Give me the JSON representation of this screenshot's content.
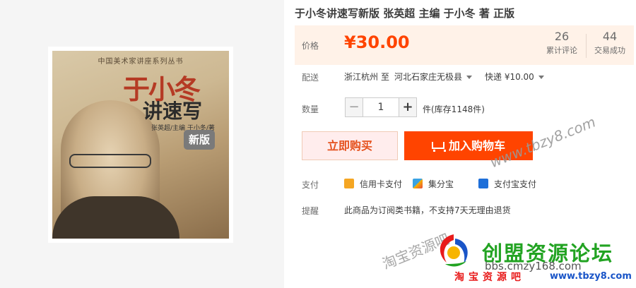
{
  "product": {
    "title": "于小冬讲速写新版 张英超 主编 于小冬 著 正版",
    "cover": {
      "series": "中国美术家讲座系列丛书",
      "main_title": "于小冬",
      "subtitle": "讲速写",
      "author_line": "张英超/主编 于小冬/著",
      "badge": "新版"
    }
  },
  "price": {
    "label": "价格",
    "value": "¥30.00",
    "reviews_count": "26",
    "reviews_label": "累计评论",
    "sales_count": "44",
    "sales_label": "交易成功"
  },
  "shipping": {
    "label": "配送",
    "from": "浙江杭州",
    "to_word": "至",
    "destination": "河北石家庄无极县",
    "method": "快递 ¥10.00"
  },
  "quantity": {
    "label": "数量",
    "minus": "−",
    "value": "1",
    "plus": "+",
    "stock": "件(库存1148件)"
  },
  "actions": {
    "buy_now": "立即购买",
    "add_to_cart": "加入购物车"
  },
  "payment": {
    "label": "支付",
    "options": [
      {
        "name": "信用卡支付",
        "icon": "credit-card-icon",
        "color": "#f5a623"
      },
      {
        "name": "集分宝",
        "icon": "jifenbao-icon",
        "color": "#3aa3e3"
      },
      {
        "name": "支付宝支付",
        "icon": "alipay-icon",
        "color": "#1e6fd9"
      }
    ]
  },
  "notice": {
    "label": "提醒",
    "text": "此商品为订阅类书籍，不支持7天无理由退货"
  },
  "watermark": {
    "site": "www.tbzy8.com",
    "name": "淘宝资源吧",
    "forum": "创盟资源论坛",
    "url": "bbs.cmzy168.com",
    "bottom_text": "淘宝资源吧",
    "bottom_url": "www.tbzy8.com"
  },
  "colors": {
    "accent": "#ff4400",
    "price": "#ff4400",
    "price_bg": "#fff2e8"
  }
}
